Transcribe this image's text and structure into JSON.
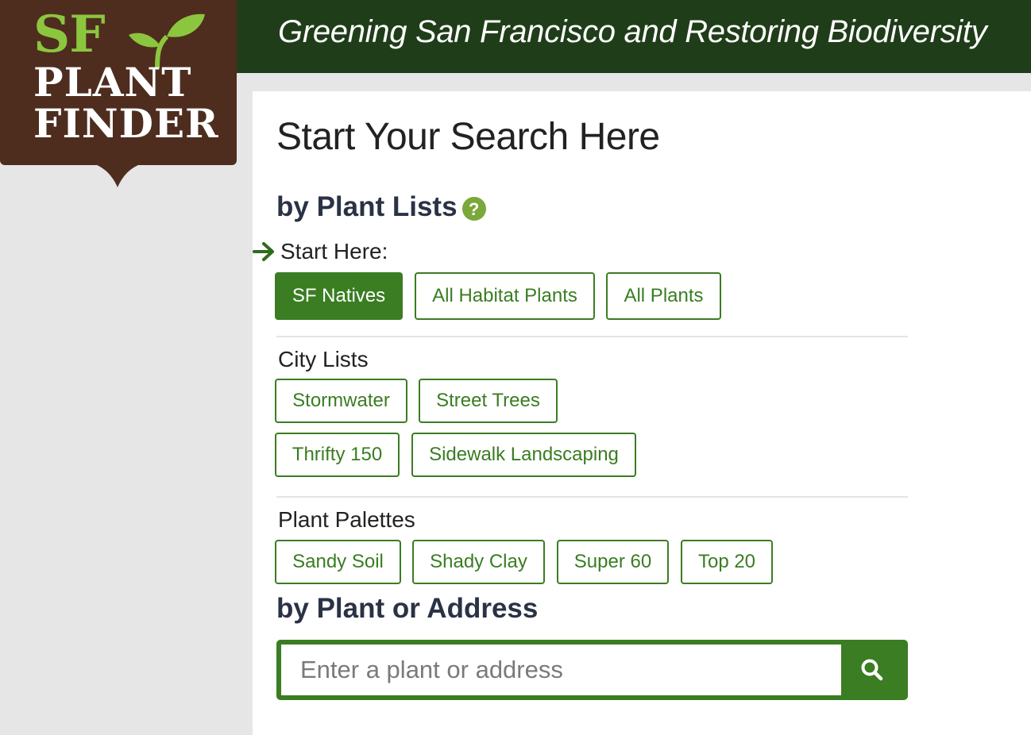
{
  "header": {
    "tagline": "Greening San Francisco and Restoring Biodiversity",
    "background_color": "#1f3d19"
  },
  "logo": {
    "line1": "SF",
    "line2": "PLANT",
    "line3": "FINDER",
    "icon": "sprout-icon"
  },
  "main": {
    "title": "Start Your Search Here",
    "plant_lists": {
      "heading": "by Plant Lists",
      "help_icon": "help-icon",
      "start_label": "Start Here:",
      "start_buttons": [
        "SF Natives",
        "All Habitat Plants",
        "All Plants"
      ],
      "selected": "SF Natives"
    },
    "city_lists": {
      "label": "City Lists",
      "buttons": [
        "Stormwater",
        "Street Trees",
        "Thrifty 150",
        "Sidewalk Landscaping"
      ]
    },
    "plant_palettes": {
      "label": "Plant Palettes",
      "buttons": [
        "Sandy Soil",
        "Shady Clay",
        "Super 60",
        "Top 20"
      ]
    },
    "search": {
      "heading": "by Plant or Address",
      "placeholder": "Enter a plant or address",
      "value": "",
      "button_icon": "search-icon"
    }
  },
  "colors": {
    "accent": "#3a7d22",
    "logo_brown": "#4e2d1f",
    "logo_green": "#8cc63f"
  }
}
